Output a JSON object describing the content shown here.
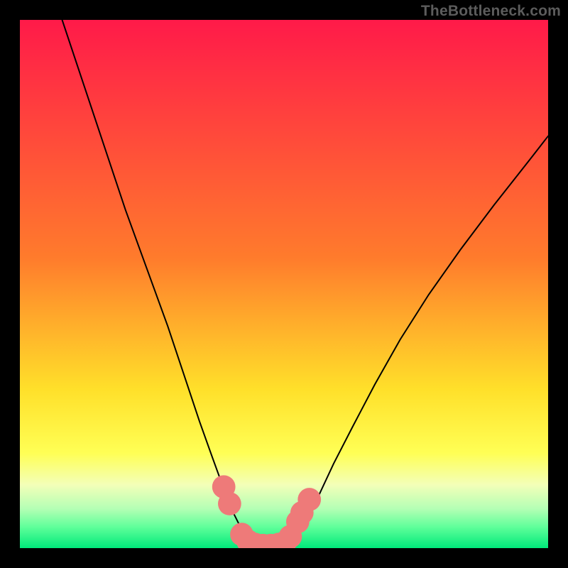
{
  "watermark": "TheBottleneck.com",
  "chart_data": {
    "type": "line",
    "title": "",
    "xlabel": "",
    "ylabel": "",
    "xlim": [
      0,
      100
    ],
    "ylim": [
      0,
      100
    ],
    "grid": false,
    "legend": false,
    "annotations": [],
    "background_gradient_stops": [
      {
        "pos": 0,
        "color": "#ff1a49"
      },
      {
        "pos": 45,
        "color": "#ff7b2c"
      },
      {
        "pos": 70,
        "color": "#ffe02a"
      },
      {
        "pos": 82,
        "color": "#ffff55"
      },
      {
        "pos": 88,
        "color": "#f3ffb8"
      },
      {
        "pos": 92.5,
        "color": "#b5ffb5"
      },
      {
        "pos": 96,
        "color": "#5fff9a"
      },
      {
        "pos": 100,
        "color": "#00e97a"
      }
    ],
    "series": [
      {
        "name": "left-branch",
        "x": [
          8,
          12,
          16,
          20,
          24,
          28,
          31,
          34,
          36.5,
          38.5,
          40,
          41.5,
          42.8,
          43.8
        ],
        "y": [
          100,
          88,
          76,
          64,
          53,
          42,
          33,
          24,
          17,
          11.5,
          7.5,
          4.5,
          2.5,
          1.0
        ]
      },
      {
        "name": "right-branch",
        "x": [
          51.8,
          52.8,
          54.4,
          56.6,
          59.4,
          63,
          67.2,
          72,
          77.4,
          83.4,
          89.8,
          96.5,
          100
        ],
        "y": [
          1.0,
          2.5,
          5.5,
          10,
          16,
          23,
          31,
          39.5,
          48,
          56.5,
          65,
          73.5,
          78
        ]
      }
    ],
    "markers": [
      {
        "name": "upper-dots-left",
        "x": [
          38.6,
          39.7
        ],
        "y": [
          11.6,
          8.4
        ]
      },
      {
        "name": "upper-dots-right",
        "x": [
          52.6,
          53.4,
          54.8
        ],
        "y": [
          5.0,
          6.7,
          9.2
        ]
      },
      {
        "name": "bottom-cluster",
        "x": [
          42.0,
          43.2,
          44.5,
          46.0,
          47.5,
          49.0,
          50.2,
          51.2
        ],
        "y": [
          2.6,
          1.3,
          0.7,
          0.5,
          0.5,
          0.7,
          1.1,
          2.2
        ]
      }
    ],
    "marker_style": {
      "color": "#ee7a79",
      "radius": 2.2
    }
  }
}
